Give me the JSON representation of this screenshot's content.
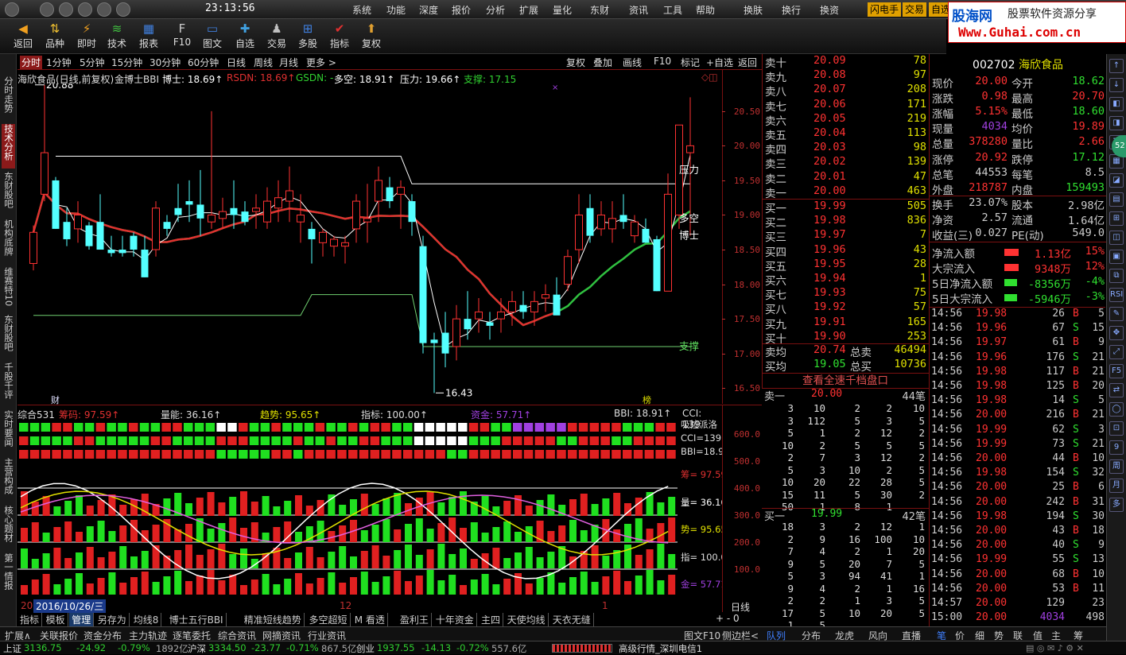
{
  "clock": "23:13:56",
  "menu": [
    "系统",
    "功能",
    "深度",
    "报价",
    "分析",
    "扩展",
    "量化",
    "东财",
    "资讯",
    "工具",
    "帮助",
    "换肤",
    "换行",
    "换资"
  ],
  "menu_hl": [
    "闪电手",
    "交易",
    "自选"
  ],
  "logo": {
    "brand": "股海网",
    "slogan": "股票软件资源分享",
    "url": "Www.Guhai.com.cn"
  },
  "toolbar": [
    "返回",
    "品种",
    "即时",
    "技术",
    "报表",
    "F10",
    "图文",
    "自选",
    "交易",
    "多股",
    "指标",
    "复权"
  ],
  "leftnav": [
    "分时走势",
    "技术分析",
    "东财股吧",
    "机构底牌",
    "维赛特10",
    "东财股吧",
    "千股千评",
    "实时要闻",
    "主营构成",
    "核心题材",
    "第一情报"
  ],
  "timeframes": [
    "分时",
    "1分钟",
    "5分钟",
    "15分钟",
    "30分钟",
    "60分钟",
    "日线",
    "周线",
    "月线",
    "更多 >"
  ],
  "chart_buttons": [
    "复权",
    "叠加",
    "画线",
    "F10",
    "标记",
    "+自选",
    "返回"
  ],
  "info": {
    "name": "海欣食品(日线,前复权)",
    "ind": "金博士BBI",
    "boshi": "博士: 18.69↑",
    "rsdn": "RSDN: 18.69↑",
    "gsdn": "GSDN: -",
    "duokong": "多空: 18.91↑",
    "yali": "压力: 19.66↑",
    "zhicheng": "支撑: 17.15"
  },
  "chart_labels": {
    "high": "20.88",
    "low": "16.43",
    "yali": "压力",
    "duokong": "多空",
    "boshi": "博士",
    "zhicheng": "支撑",
    "cai": "财",
    "bang": "榜"
  },
  "axis_prices": [
    "20.50",
    "20.00",
    "19.50",
    "19.00",
    "18.50",
    "18.00",
    "17.50",
    "17.00",
    "16.50"
  ],
  "ind_header": {
    "a": "综合531",
    "b": "筹码: 97.59↑",
    "c": "量能: 36.16↑",
    "d": "趋势: 95.65↑",
    "e": "指标: 100.00↑",
    "f": "资金: 57.71↑",
    "g": "BBI: 18.91↑",
    "h": "CCI: 139"
  },
  "ind_side": [
    "吸拉派洛",
    "CCI=139.",
    "BBI=18.9",
    "筹= 97.59",
    "量= 36.16",
    "势= 95.65",
    "指= 100.0",
    "金= 57.71"
  ],
  "ind_axis": [
    "600.0",
    "500.0",
    "400.0",
    "300.0",
    "200.0",
    "100.0"
  ],
  "datebar": {
    "year": "20",
    "date": "2016/10/26/三",
    "m12": "12",
    "m1": "1",
    "period": "日线"
  },
  "tabs": [
    "指标",
    "模板",
    "管理",
    "另存为",
    "均线8",
    "博士五行BBI",
    "精准短线趋势",
    "多空超短",
    "M 看透",
    "盈利王",
    "十年资金",
    "主四",
    "天使均线",
    "天衣无缝"
  ],
  "bottom_tabs": [
    "扩展∧",
    "关联报价",
    "资金分布",
    "主力轨迹",
    "逐笔委托",
    "综合资讯",
    "网摘资讯",
    "行业资讯"
  ],
  "bottom_right": [
    "图文F10",
    "侧边栏<"
  ],
  "sell_orders": [
    [
      "卖十",
      "20.09",
      "78"
    ],
    [
      "卖九",
      "20.08",
      "97"
    ],
    [
      "卖八",
      "20.07",
      "208"
    ],
    [
      "卖七",
      "20.06",
      "171"
    ],
    [
      "卖六",
      "20.05",
      "219"
    ],
    [
      "卖五",
      "20.04",
      "113"
    ],
    [
      "卖四",
      "20.03",
      "98"
    ],
    [
      "卖三",
      "20.02",
      "139"
    ],
    [
      "卖二",
      "20.01",
      "47"
    ],
    [
      "卖一",
      "20.00",
      "463"
    ]
  ],
  "buy_orders": [
    [
      "买一",
      "19.99",
      "505"
    ],
    [
      "买二",
      "19.98",
      "836"
    ],
    [
      "买三",
      "19.97",
      "7"
    ],
    [
      "买四",
      "19.96",
      "43"
    ],
    [
      "买五",
      "19.95",
      "28"
    ],
    [
      "买六",
      "19.94",
      "1"
    ],
    [
      "买七",
      "19.93",
      "75"
    ],
    [
      "买八",
      "19.92",
      "57"
    ],
    [
      "买九",
      "19.91",
      "165"
    ],
    [
      "买十",
      "19.90",
      "253"
    ]
  ],
  "avg": {
    "sell_label": "卖均",
    "sell_price": "20.74",
    "sell_tot_label": "总卖",
    "sell_tot": "46494",
    "buy_label": "买均",
    "buy_price": "19.05",
    "buy_tot_label": "总买",
    "buy_tot": "10736"
  },
  "view_all": "查看全速千档盘口",
  "sell1": {
    "label": "卖一",
    "price": "20.00",
    "count": "44笔"
  },
  "buy1": {
    "label": "买一",
    "price": "19.99",
    "count": "42笔"
  },
  "sell_detail": [
    [
      "3",
      "10",
      "2",
      "2",
      "10"
    ],
    [
      "3",
      "112",
      "5",
      "3",
      "5"
    ],
    [
      "5",
      "1",
      "2",
      "12",
      "2"
    ],
    [
      "10",
      "2",
      "5",
      "5",
      "5"
    ],
    [
      "2",
      "7",
      "3",
      "12",
      "2"
    ],
    [
      "5",
      "3",
      "10",
      "2",
      "5"
    ],
    [
      "10",
      "20",
      "22",
      "28",
      "5"
    ],
    [
      "15",
      "11",
      "5",
      "30",
      "2"
    ],
    [
      "50",
      "1",
      "8",
      "1",
      ""
    ]
  ],
  "buy_detail": [
    [
      "18",
      "3",
      "2",
      "12",
      "1"
    ],
    [
      "2",
      "9",
      "16",
      "100",
      "10"
    ],
    [
      "7",
      "4",
      "2",
      "1",
      "20"
    ],
    [
      "9",
      "5",
      "20",
      "7",
      "5"
    ],
    [
      "5",
      "3",
      "94",
      "41",
      "1"
    ],
    [
      "9",
      "4",
      "2",
      "1",
      "16"
    ],
    [
      "2",
      "2",
      "1",
      "3",
      "5"
    ],
    [
      "17",
      "5",
      "10",
      "20",
      "5"
    ],
    [
      "1",
      "5",
      "",
      "",
      ""
    ]
  ],
  "stock": {
    "code": "002702",
    "name": "海欣食品"
  },
  "quote": [
    [
      "现价",
      "20.00",
      "今开",
      "18.62"
    ],
    [
      "涨跌",
      "0.98",
      "最高",
      "20.70"
    ],
    [
      "涨幅",
      "5.15%",
      "最低",
      "18.60"
    ],
    [
      "现量",
      "4034",
      "均价",
      "19.89"
    ],
    [
      "总量",
      "378280",
      "量比",
      "2.66"
    ],
    [
      "涨停",
      "20.92",
      "跌停",
      "17.12"
    ],
    [
      "总笔",
      "44553",
      "每笔",
      "8.5"
    ],
    [
      "外盘",
      "218787",
      "内盘",
      "159493"
    ],
    [
      "换手",
      "23.07%",
      "股本",
      "2.98亿"
    ],
    [
      "净资",
      "2.57",
      "流通",
      "1.64亿"
    ],
    [
      "收益(三)",
      "0.027",
      "PE(动)",
      "549.0"
    ]
  ],
  "flows": [
    [
      "净流入额",
      "1.13亿",
      "15%"
    ],
    [
      "大宗流入",
      "9348万",
      "12%"
    ],
    [
      "5日净流入额",
      "-8356万",
      "-4%"
    ],
    [
      "5日大宗流入",
      "-5946万",
      "-3%"
    ]
  ],
  "ticks": [
    [
      "14:56",
      "19.98",
      "26",
      "B",
      "5"
    ],
    [
      "14:56",
      "19.96",
      "67",
      "S",
      "15"
    ],
    [
      "14:56",
      "19.97",
      "61",
      "B",
      "9"
    ],
    [
      "14:56",
      "19.96",
      "176",
      "S",
      "21"
    ],
    [
      "14:56",
      "19.98",
      "117",
      "B",
      "21"
    ],
    [
      "14:56",
      "19.98",
      "125",
      "B",
      "20"
    ],
    [
      "14:56",
      "19.98",
      "14",
      "S",
      "5"
    ],
    [
      "14:56",
      "20.00",
      "216",
      "B",
      "21"
    ],
    [
      "14:56",
      "19.99",
      "62",
      "S",
      "3"
    ],
    [
      "14:56",
      "19.99",
      "73",
      "S",
      "21"
    ],
    [
      "14:56",
      "20.00",
      "44",
      "B",
      "10"
    ],
    [
      "14:56",
      "19.98",
      "154",
      "S",
      "32"
    ],
    [
      "14:56",
      "20.00",
      "25",
      "B",
      "6"
    ],
    [
      "14:56",
      "20.00",
      "242",
      "B",
      "31"
    ],
    [
      "14:56",
      "19.98",
      "194",
      "S",
      "30"
    ],
    [
      "14:56",
      "20.00",
      "43",
      "B",
      "18"
    ],
    [
      "14:56",
      "20.00",
      "40",
      "S",
      "9"
    ],
    [
      "14:56",
      "19.99",
      "55",
      "S",
      "13"
    ],
    [
      "14:56",
      "20.00",
      "68",
      "B",
      "10"
    ],
    [
      "14:56",
      "20.00",
      "53",
      "B",
      "11"
    ],
    [
      "14:57",
      "20.00",
      "129",
      "",
      "23"
    ],
    [
      "15:00",
      "20.00",
      "4034",
      "",
      "498"
    ]
  ],
  "rtabs": [
    "队列",
    "分布",
    "龙虎",
    "风向",
    "直播",
    "笔",
    "价",
    "细",
    "势",
    "联",
    "值",
    "主",
    "筹"
  ],
  "status": {
    "sh_label": "上证",
    "sh": "3136.75",
    "sh_chg": "-24.92",
    "sh_pct": "-0.79%",
    "sh_amt": "1892亿",
    "hs_label": "沪深",
    "hs": "3334.50",
    "hs_chg": "-23.77",
    "hs_pct": "-0.71%",
    "hs_amt": "867.5亿",
    "cy_label": "创业",
    "cy": "1937.55",
    "cy_chg": "-14.13",
    "cy_pct": "-0.72%",
    "cy_amt": "557.6亿",
    "net": "高级行情_深圳电信1"
  },
  "chart_data": {
    "type": "candlestick",
    "candles_ohlc": [
      [
        18.3,
        18.85,
        18.2,
        18.75
      ],
      [
        19.3,
        20.88,
        19.2,
        19.9
      ],
      [
        19.5,
        19.55,
        18.8,
        18.8
      ],
      [
        18.9,
        19.1,
        18.55,
        18.65
      ],
      [
        18.8,
        19.2,
        18.6,
        19.0
      ],
      [
        18.85,
        18.9,
        18.5,
        18.55
      ],
      [
        18.9,
        19.3,
        18.7,
        18.5
      ],
      [
        18.5,
        18.7,
        18.4,
        18.45
      ],
      [
        18.5,
        18.7,
        18.4,
        18.45
      ],
      [
        18.7,
        18.75,
        18.4,
        18.5
      ],
      [
        18.5,
        18.7,
        18.1,
        18.1
      ],
      [
        18.5,
        19.2,
        18.4,
        19.1
      ],
      [
        18.9,
        19.0,
        18.7,
        18.8
      ],
      [
        19.1,
        19.45,
        18.9,
        19.0
      ],
      [
        19.2,
        19.5,
        18.9,
        19.15
      ],
      [
        19.15,
        19.65,
        18.7,
        18.95
      ],
      [
        18.9,
        20.5,
        18.8,
        19.0
      ],
      [
        18.95,
        19.25,
        18.8,
        19.05
      ],
      [
        19.1,
        19.5,
        18.8,
        19.0
      ],
      [
        19.05,
        19.2,
        18.85,
        18.9
      ],
      [
        19.05,
        19.3,
        18.8,
        19.1
      ],
      [
        18.9,
        19.4,
        18.8,
        19.2
      ],
      [
        19.1,
        19.5,
        18.9,
        19.25
      ],
      [
        19.2,
        19.7,
        18.9,
        19.35
      ],
      [
        18.9,
        19.3,
        18.6,
        19.0
      ],
      [
        18.8,
        18.9,
        18.3,
        18.65
      ],
      [
        18.6,
        18.8,
        18.4,
        18.75
      ],
      [
        18.55,
        18.7,
        18.4,
        18.65
      ],
      [
        18.55,
        18.7,
        18.3,
        18.6
      ],
      [
        18.8,
        19.3,
        18.6,
        19.2
      ],
      [
        18.9,
        19.45,
        18.6,
        18.95
      ],
      [
        19.2,
        19.7,
        18.9,
        19.5
      ],
      [
        19.4,
        19.55,
        19.1,
        19.2
      ],
      [
        19.3,
        19.5,
        18.8,
        19.4
      ],
      [
        19.2,
        19.3,
        18.7,
        18.9
      ],
      [
        18.55,
        18.7,
        17.0,
        17.15
      ],
      [
        17.2,
        17.3,
        16.43,
        17.15
      ],
      [
        17.3,
        17.6,
        16.8,
        17.0
      ],
      [
        17.1,
        17.7,
        16.9,
        17.5
      ],
      [
        17.5,
        17.9,
        17.2,
        17.35
      ],
      [
        17.5,
        17.8,
        17.3,
        17.6
      ],
      [
        17.45,
        17.6,
        17.2,
        17.4
      ],
      [
        17.5,
        17.8,
        17.3,
        17.6
      ],
      [
        17.6,
        17.9,
        17.4,
        17.75
      ],
      [
        17.7,
        17.9,
        17.5,
        17.6
      ],
      [
        17.6,
        17.9,
        17.4,
        17.75
      ],
      [
        17.8,
        18.0,
        17.6,
        17.85
      ],
      [
        17.85,
        18.1,
        17.6,
        17.55
      ],
      [
        18.0,
        18.5,
        17.9,
        18.4
      ],
      [
        18.5,
        19.3,
        18.3,
        19.0
      ],
      [
        19.1,
        19.3,
        18.6,
        18.7
      ],
      [
        18.8,
        19.2,
        18.7,
        19.0
      ],
      [
        18.8,
        19.2,
        18.6,
        18.95
      ],
      [
        19.0,
        19.3,
        18.8,
        18.9
      ],
      [
        18.7,
        19.0,
        18.6,
        18.9
      ],
      [
        18.8,
        18.95,
        18.6,
        18.6
      ],
      [
        18.65,
        18.7,
        17.9,
        17.9
      ],
      [
        17.9,
        19.6,
        17.9,
        19.3
      ],
      [
        19.0,
        20.3,
        18.8,
        20.3
      ],
      [
        19.9,
        20.7,
        18.7,
        20.0
      ]
    ],
    "ylim": [
      16.25,
      20.9
    ],
    "labels": {
      "high": "20.88",
      "low": "16.43"
    }
  }
}
